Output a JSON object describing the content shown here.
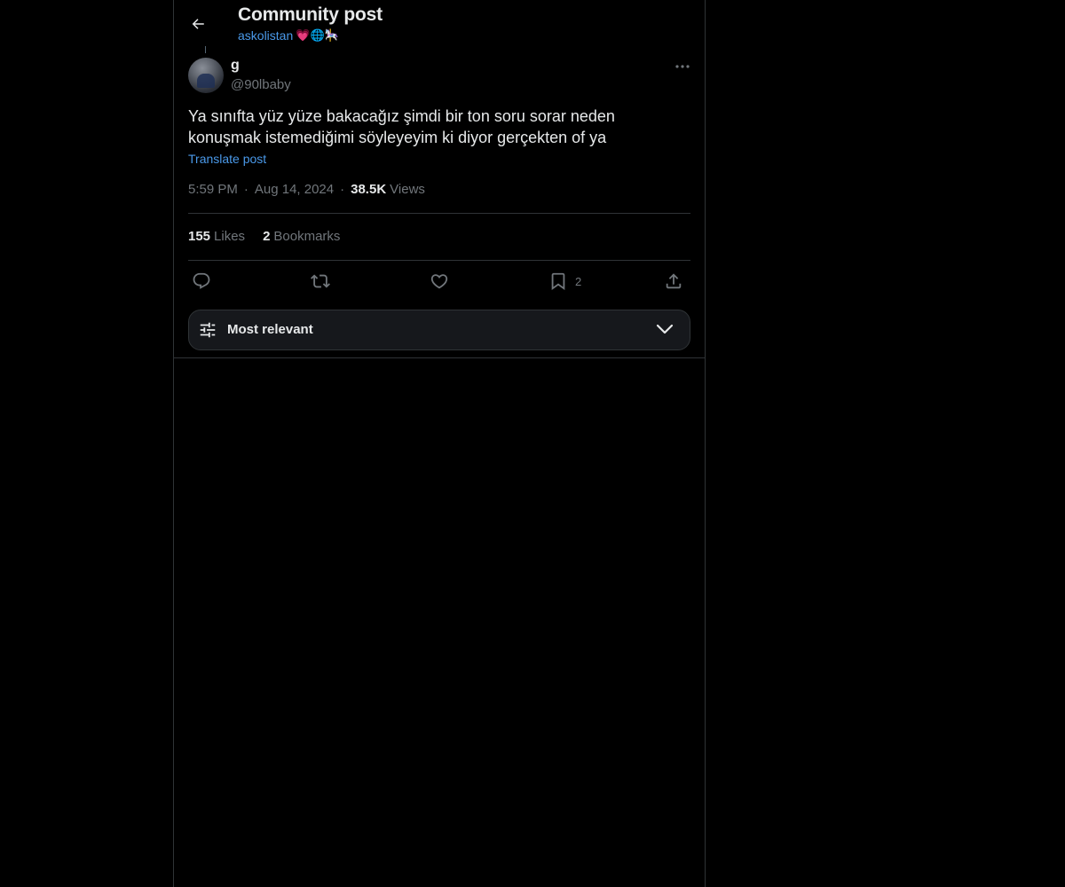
{
  "header": {
    "title": "Community post",
    "community_name": "askolistan",
    "community_emojis": "💗🌐🎠"
  },
  "post": {
    "author_name": "g",
    "author_handle": "@90lbaby",
    "text": "Ya sınıfta yüz yüze bakacağız şimdi bir ton soru sorar neden konuşmak istemediğimi söyleyeyim ki diyor gerçekten of ya",
    "translate_label": "Translate post",
    "time": "5:59 PM",
    "date": "Aug 14, 2024",
    "views_count": "38.5K",
    "views_label": "Views",
    "likes_count": "155",
    "likes_label": "Likes",
    "bookmarks_count": "2",
    "bookmarks_label": "Bookmarks",
    "bookmark_action_count": "2"
  },
  "sort": {
    "label": "Most relevant"
  },
  "colors": {
    "background": "#000000",
    "text": "#e7e9ea",
    "muted": "#71767b",
    "accent": "#4a99e9",
    "border": "#2f3336"
  },
  "icons": {
    "back": "arrow-left-icon",
    "more": "more-dots-icon",
    "reply": "reply-icon",
    "repost": "repost-icon",
    "like": "heart-icon",
    "bookmark": "bookmark-icon",
    "share": "share-icon",
    "sort": "sliders-icon",
    "chevron": "chevron-down-icon"
  }
}
